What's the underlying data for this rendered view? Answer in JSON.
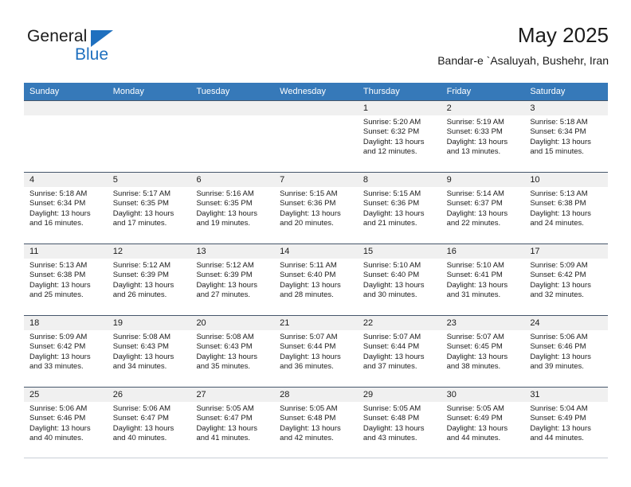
{
  "brand": {
    "name_top": "General",
    "name_bottom": "Blue",
    "accent_color": "#1f70bf"
  },
  "header": {
    "title": "May 2025",
    "subtitle": "Bandar-e `Asaluyah, Bushehr, Iran"
  },
  "calendar": {
    "header_color": "#3679b9",
    "day_band_color": "#f0f0f0",
    "row_rule_color": "#45566b",
    "weekdays": [
      "Sunday",
      "Monday",
      "Tuesday",
      "Wednesday",
      "Thursday",
      "Friday",
      "Saturday"
    ],
    "weeks": [
      [
        {
          "day": "",
          "sunrise": "",
          "sunset": "",
          "daylight_line1": "",
          "daylight_line2": ""
        },
        {
          "day": "",
          "sunrise": "",
          "sunset": "",
          "daylight_line1": "",
          "daylight_line2": ""
        },
        {
          "day": "",
          "sunrise": "",
          "sunset": "",
          "daylight_line1": "",
          "daylight_line2": ""
        },
        {
          "day": "",
          "sunrise": "",
          "sunset": "",
          "daylight_line1": "",
          "daylight_line2": ""
        },
        {
          "day": "1",
          "sunrise": "Sunrise: 5:20 AM",
          "sunset": "Sunset: 6:32 PM",
          "daylight_line1": "Daylight: 13 hours",
          "daylight_line2": "and 12 minutes."
        },
        {
          "day": "2",
          "sunrise": "Sunrise: 5:19 AM",
          "sunset": "Sunset: 6:33 PM",
          "daylight_line1": "Daylight: 13 hours",
          "daylight_line2": "and 13 minutes."
        },
        {
          "day": "3",
          "sunrise": "Sunrise: 5:18 AM",
          "sunset": "Sunset: 6:34 PM",
          "daylight_line1": "Daylight: 13 hours",
          "daylight_line2": "and 15 minutes."
        }
      ],
      [
        {
          "day": "4",
          "sunrise": "Sunrise: 5:18 AM",
          "sunset": "Sunset: 6:34 PM",
          "daylight_line1": "Daylight: 13 hours",
          "daylight_line2": "and 16 minutes."
        },
        {
          "day": "5",
          "sunrise": "Sunrise: 5:17 AM",
          "sunset": "Sunset: 6:35 PM",
          "daylight_line1": "Daylight: 13 hours",
          "daylight_line2": "and 17 minutes."
        },
        {
          "day": "6",
          "sunrise": "Sunrise: 5:16 AM",
          "sunset": "Sunset: 6:35 PM",
          "daylight_line1": "Daylight: 13 hours",
          "daylight_line2": "and 19 minutes."
        },
        {
          "day": "7",
          "sunrise": "Sunrise: 5:15 AM",
          "sunset": "Sunset: 6:36 PM",
          "daylight_line1": "Daylight: 13 hours",
          "daylight_line2": "and 20 minutes."
        },
        {
          "day": "8",
          "sunrise": "Sunrise: 5:15 AM",
          "sunset": "Sunset: 6:36 PM",
          "daylight_line1": "Daylight: 13 hours",
          "daylight_line2": "and 21 minutes."
        },
        {
          "day": "9",
          "sunrise": "Sunrise: 5:14 AM",
          "sunset": "Sunset: 6:37 PM",
          "daylight_line1": "Daylight: 13 hours",
          "daylight_line2": "and 22 minutes."
        },
        {
          "day": "10",
          "sunrise": "Sunrise: 5:13 AM",
          "sunset": "Sunset: 6:38 PM",
          "daylight_line1": "Daylight: 13 hours",
          "daylight_line2": "and 24 minutes."
        }
      ],
      [
        {
          "day": "11",
          "sunrise": "Sunrise: 5:13 AM",
          "sunset": "Sunset: 6:38 PM",
          "daylight_line1": "Daylight: 13 hours",
          "daylight_line2": "and 25 minutes."
        },
        {
          "day": "12",
          "sunrise": "Sunrise: 5:12 AM",
          "sunset": "Sunset: 6:39 PM",
          "daylight_line1": "Daylight: 13 hours",
          "daylight_line2": "and 26 minutes."
        },
        {
          "day": "13",
          "sunrise": "Sunrise: 5:12 AM",
          "sunset": "Sunset: 6:39 PM",
          "daylight_line1": "Daylight: 13 hours",
          "daylight_line2": "and 27 minutes."
        },
        {
          "day": "14",
          "sunrise": "Sunrise: 5:11 AM",
          "sunset": "Sunset: 6:40 PM",
          "daylight_line1": "Daylight: 13 hours",
          "daylight_line2": "and 28 minutes."
        },
        {
          "day": "15",
          "sunrise": "Sunrise: 5:10 AM",
          "sunset": "Sunset: 6:40 PM",
          "daylight_line1": "Daylight: 13 hours",
          "daylight_line2": "and 30 minutes."
        },
        {
          "day": "16",
          "sunrise": "Sunrise: 5:10 AM",
          "sunset": "Sunset: 6:41 PM",
          "daylight_line1": "Daylight: 13 hours",
          "daylight_line2": "and 31 minutes."
        },
        {
          "day": "17",
          "sunrise": "Sunrise: 5:09 AM",
          "sunset": "Sunset: 6:42 PM",
          "daylight_line1": "Daylight: 13 hours",
          "daylight_line2": "and 32 minutes."
        }
      ],
      [
        {
          "day": "18",
          "sunrise": "Sunrise: 5:09 AM",
          "sunset": "Sunset: 6:42 PM",
          "daylight_line1": "Daylight: 13 hours",
          "daylight_line2": "and 33 minutes."
        },
        {
          "day": "19",
          "sunrise": "Sunrise: 5:08 AM",
          "sunset": "Sunset: 6:43 PM",
          "daylight_line1": "Daylight: 13 hours",
          "daylight_line2": "and 34 minutes."
        },
        {
          "day": "20",
          "sunrise": "Sunrise: 5:08 AM",
          "sunset": "Sunset: 6:43 PM",
          "daylight_line1": "Daylight: 13 hours",
          "daylight_line2": "and 35 minutes."
        },
        {
          "day": "21",
          "sunrise": "Sunrise: 5:07 AM",
          "sunset": "Sunset: 6:44 PM",
          "daylight_line1": "Daylight: 13 hours",
          "daylight_line2": "and 36 minutes."
        },
        {
          "day": "22",
          "sunrise": "Sunrise: 5:07 AM",
          "sunset": "Sunset: 6:44 PM",
          "daylight_line1": "Daylight: 13 hours",
          "daylight_line2": "and 37 minutes."
        },
        {
          "day": "23",
          "sunrise": "Sunrise: 5:07 AM",
          "sunset": "Sunset: 6:45 PM",
          "daylight_line1": "Daylight: 13 hours",
          "daylight_line2": "and 38 minutes."
        },
        {
          "day": "24",
          "sunrise": "Sunrise: 5:06 AM",
          "sunset": "Sunset: 6:46 PM",
          "daylight_line1": "Daylight: 13 hours",
          "daylight_line2": "and 39 minutes."
        }
      ],
      [
        {
          "day": "25",
          "sunrise": "Sunrise: 5:06 AM",
          "sunset": "Sunset: 6:46 PM",
          "daylight_line1": "Daylight: 13 hours",
          "daylight_line2": "and 40 minutes."
        },
        {
          "day": "26",
          "sunrise": "Sunrise: 5:06 AM",
          "sunset": "Sunset: 6:47 PM",
          "daylight_line1": "Daylight: 13 hours",
          "daylight_line2": "and 40 minutes."
        },
        {
          "day": "27",
          "sunrise": "Sunrise: 5:05 AM",
          "sunset": "Sunset: 6:47 PM",
          "daylight_line1": "Daylight: 13 hours",
          "daylight_line2": "and 41 minutes."
        },
        {
          "day": "28",
          "sunrise": "Sunrise: 5:05 AM",
          "sunset": "Sunset: 6:48 PM",
          "daylight_line1": "Daylight: 13 hours",
          "daylight_line2": "and 42 minutes."
        },
        {
          "day": "29",
          "sunrise": "Sunrise: 5:05 AM",
          "sunset": "Sunset: 6:48 PM",
          "daylight_line1": "Daylight: 13 hours",
          "daylight_line2": "and 43 minutes."
        },
        {
          "day": "30",
          "sunrise": "Sunrise: 5:05 AM",
          "sunset": "Sunset: 6:49 PM",
          "daylight_line1": "Daylight: 13 hours",
          "daylight_line2": "and 44 minutes."
        },
        {
          "day": "31",
          "sunrise": "Sunrise: 5:04 AM",
          "sunset": "Sunset: 6:49 PM",
          "daylight_line1": "Daylight: 13 hours",
          "daylight_line2": "and 44 minutes."
        }
      ]
    ]
  }
}
